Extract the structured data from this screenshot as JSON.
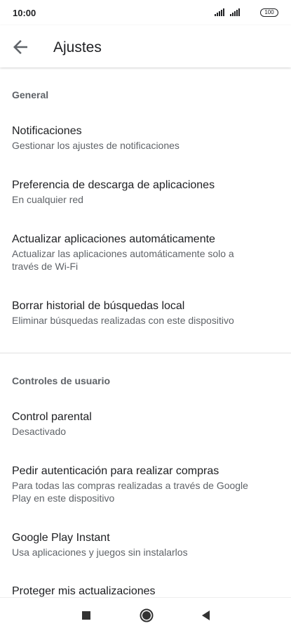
{
  "status_bar": {
    "time": "10:00",
    "battery": "100"
  },
  "app_bar": {
    "title": "Ajustes"
  },
  "sections": {
    "general": {
      "header": "General",
      "items": [
        {
          "title": "Notificaciones",
          "subtitle": "Gestionar los ajustes de notificaciones"
        },
        {
          "title": "Preferencia de descarga de aplicaciones",
          "subtitle": "En cualquier red"
        },
        {
          "title": "Actualizar aplicaciones automáticamente",
          "subtitle_line1": "Actualizar las aplicaciones automáticamente solo a",
          "subtitle_line2": "través de Wi-Fi"
        },
        {
          "title": "Borrar historial de búsquedas local",
          "subtitle": "Eliminar búsquedas realizadas con este dispositivo"
        }
      ]
    },
    "user_controls": {
      "header": "Controles de usuario",
      "items": [
        {
          "title": "Control parental",
          "subtitle": "Desactivado"
        },
        {
          "title": "Pedir autenticación para realizar compras",
          "subtitle_line1": "Para todas las compras realizadas a través de Google",
          "subtitle_line2": "Play en este dispositivo"
        },
        {
          "title": "Google Play Instant",
          "subtitle": "Usa aplicaciones y juegos sin instalarlos"
        },
        {
          "title": "Proteger mis actualizaciones"
        }
      ]
    }
  },
  "icons": {
    "back": "arrow-back-icon",
    "signal": "signal-icon",
    "battery": "battery-icon",
    "nav_recent": "square-icon",
    "nav_home": "circle-icon",
    "nav_back": "triangle-back-icon"
  },
  "colors": {
    "text_primary": "#202124",
    "text_secondary": "#5f6368",
    "divider": "#e0e0e0"
  }
}
